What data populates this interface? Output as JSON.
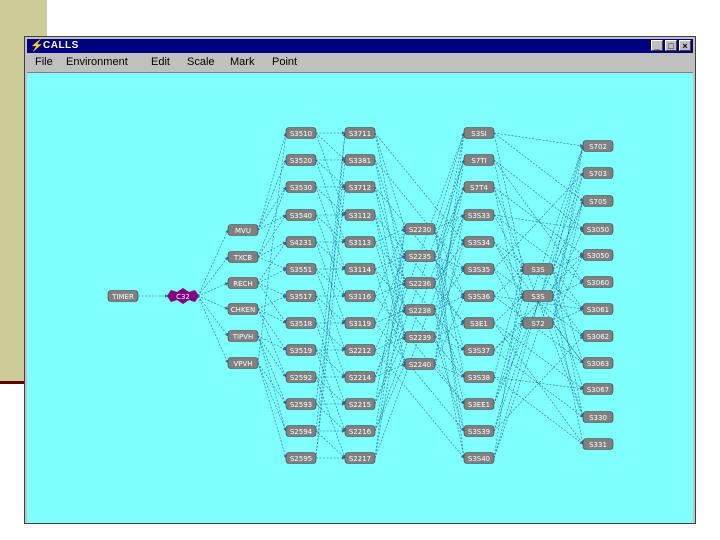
{
  "window": {
    "title": "CALLS",
    "menu": [
      "File",
      "Environment",
      "Edit",
      "Scale",
      "Mark",
      "Point"
    ],
    "controls": {
      "minimize": "_",
      "maximize": "□",
      "close": "×"
    }
  },
  "colors": {
    "canvas": "#80ffff",
    "node": "#808080",
    "node_selected": "#800080",
    "edge": "#2a6fa8",
    "titlebar": "#000080",
    "slide_side": "#cccc99"
  },
  "graph": {
    "nodes": [
      {
        "id": "n1",
        "label": "TIMER"
      },
      {
        "id": "n2",
        "label": "C32"
      },
      {
        "id": "n3",
        "label": "MVU"
      },
      {
        "id": "n4",
        "label": "TXCB"
      },
      {
        "id": "n5",
        "label": "RECH"
      },
      {
        "id": "n6",
        "label": "CHKEN"
      },
      {
        "id": "n7",
        "label": "TIPVH"
      },
      {
        "id": "n8",
        "label": "VPVH"
      },
      {
        "id": "n9",
        "label": "S3510"
      },
      {
        "id": "n10",
        "label": "S3520"
      },
      {
        "id": "n11",
        "label": "S3530"
      },
      {
        "id": "n12",
        "label": "S3540"
      },
      {
        "id": "n13",
        "label": "S4231"
      },
      {
        "id": "n14",
        "label": "S3551"
      },
      {
        "id": "n15",
        "label": "S3517"
      },
      {
        "id": "n16",
        "label": "S3518"
      },
      {
        "id": "n17",
        "label": "S3519"
      },
      {
        "id": "n18",
        "label": "S2592"
      },
      {
        "id": "n19",
        "label": "S2593"
      },
      {
        "id": "n20",
        "label": "S2594"
      },
      {
        "id": "n21",
        "label": "S2595"
      },
      {
        "id": "n22",
        "label": "S3711"
      },
      {
        "id": "n23",
        "label": "S3381"
      },
      {
        "id": "n24",
        "label": "S3712"
      },
      {
        "id": "n25",
        "label": "S3112"
      },
      {
        "id": "n26",
        "label": "S3113"
      },
      {
        "id": "n27",
        "label": "S3114"
      },
      {
        "id": "n28",
        "label": "S3116"
      },
      {
        "id": "n29",
        "label": "S3119"
      },
      {
        "id": "n30",
        "label": "S2212"
      },
      {
        "id": "n31",
        "label": "S2214"
      },
      {
        "id": "n32",
        "label": "S2215"
      },
      {
        "id": "n33",
        "label": "S2216"
      },
      {
        "id": "n34",
        "label": "S2217"
      },
      {
        "id": "n35",
        "label": "S2230"
      },
      {
        "id": "n36",
        "label": "S2235"
      },
      {
        "id": "n37",
        "label": "S2236"
      },
      {
        "id": "n38",
        "label": "S2238"
      },
      {
        "id": "n39",
        "label": "S2239"
      },
      {
        "id": "n40",
        "label": "S2240"
      },
      {
        "id": "n41",
        "label": "S3SI"
      },
      {
        "id": "n42",
        "label": "S7TI"
      },
      {
        "id": "n43",
        "label": "S7T4"
      },
      {
        "id": "n44",
        "label": "S3S33"
      },
      {
        "id": "n45",
        "label": "S3S34"
      },
      {
        "id": "n46",
        "label": "S3S35"
      },
      {
        "id": "n47",
        "label": "S3S36"
      },
      {
        "id": "n48",
        "label": "S3E1"
      },
      {
        "id": "n49",
        "label": "S3S37"
      },
      {
        "id": "n50",
        "label": "S3S38"
      },
      {
        "id": "n51",
        "label": "S3EE1"
      },
      {
        "id": "n52",
        "label": "S3S39"
      },
      {
        "id": "n53",
        "label": "S3S40"
      },
      {
        "id": "n54",
        "label": "S3S"
      },
      {
        "id": "n55",
        "label": "S3S"
      },
      {
        "id": "n56",
        "label": "S72"
      },
      {
        "id": "n57",
        "label": "S702"
      },
      {
        "id": "n58",
        "label": "S703"
      },
      {
        "id": "n59",
        "label": "S705"
      },
      {
        "id": "n60",
        "label": "S3050"
      },
      {
        "id": "n61",
        "label": "S3050"
      },
      {
        "id": "n62",
        "label": "S3060"
      },
      {
        "id": "n63",
        "label": "S3061"
      },
      {
        "id": "n64",
        "label": "S3062"
      },
      {
        "id": "n65",
        "label": "S3063"
      },
      {
        "id": "n66",
        "label": "S3067"
      },
      {
        "id": "n67",
        "label": "S330"
      },
      {
        "id": "n68",
        "label": "S331"
      }
    ]
  }
}
